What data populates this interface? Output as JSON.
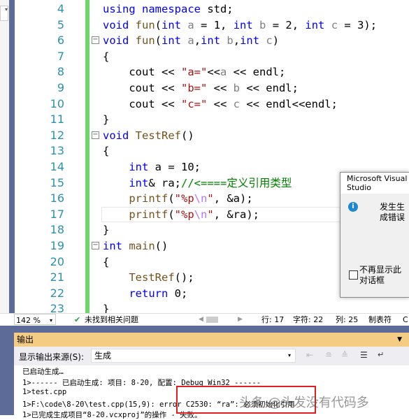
{
  "editor": {
    "lines": [
      {
        "n": "4",
        "fold": false,
        "parts": [
          [
            "kw",
            "using namespace"
          ],
          [
            "tx",
            " std;"
          ]
        ]
      },
      {
        "n": "5",
        "fold": false,
        "parts": [
          [
            "kw",
            "void"
          ],
          [
            "tx",
            " "
          ],
          [
            "fn",
            "fun"
          ],
          [
            "tx",
            "("
          ],
          [
            "kw",
            "int"
          ],
          [
            "tx",
            " "
          ],
          [
            "pm",
            "a"
          ],
          [
            "tx",
            " = 1, "
          ],
          [
            "kw",
            "int"
          ],
          [
            "tx",
            " "
          ],
          [
            "pm",
            "b"
          ],
          [
            "tx",
            " = 2, "
          ],
          [
            "kw",
            "int"
          ],
          [
            "tx",
            " "
          ],
          [
            "pm",
            "c"
          ],
          [
            "tx",
            " = 3);"
          ]
        ]
      },
      {
        "n": "6",
        "fold": true,
        "parts": [
          [
            "kw",
            "void"
          ],
          [
            "tx",
            " "
          ],
          [
            "fn",
            "fun"
          ],
          [
            "tx",
            "("
          ],
          [
            "kw",
            "int"
          ],
          [
            "tx",
            " "
          ],
          [
            "pm",
            "a"
          ],
          [
            "tx",
            ","
          ],
          [
            "kw",
            "int"
          ],
          [
            "tx",
            " "
          ],
          [
            "pm",
            "b"
          ],
          [
            "tx",
            ","
          ],
          [
            "kw",
            "int"
          ],
          [
            "tx",
            " "
          ],
          [
            "pm",
            "c"
          ],
          [
            "tx",
            ")"
          ]
        ]
      },
      {
        "n": "7",
        "fold": false,
        "parts": [
          [
            "tx",
            "{"
          ]
        ]
      },
      {
        "n": "8",
        "fold": false,
        "parts": [
          [
            "tx",
            "    cout << "
          ],
          [
            "st",
            "\"a=\""
          ],
          [
            "tx",
            "<<"
          ],
          [
            "pm",
            "a"
          ],
          [
            "tx",
            " << endl;"
          ]
        ]
      },
      {
        "n": "9",
        "fold": false,
        "parts": [
          [
            "tx",
            "    cout << "
          ],
          [
            "st",
            "\"b=\""
          ],
          [
            "tx",
            " << "
          ],
          [
            "pm",
            "b"
          ],
          [
            "tx",
            " << endl;"
          ]
        ]
      },
      {
        "n": "10",
        "fold": false,
        "parts": [
          [
            "tx",
            "    cout << "
          ],
          [
            "st",
            "\"c=\""
          ],
          [
            "tx",
            " << "
          ],
          [
            "pm",
            "c"
          ],
          [
            "tx",
            " << endl<<endl;"
          ]
        ]
      },
      {
        "n": "11",
        "fold": false,
        "parts": [
          [
            "tx",
            "}"
          ]
        ]
      },
      {
        "n": "12",
        "fold": true,
        "parts": [
          [
            "kw",
            "void"
          ],
          [
            "tx",
            " "
          ],
          [
            "fn",
            "TestRef"
          ],
          [
            "tx",
            "()"
          ]
        ]
      },
      {
        "n": "13",
        "fold": false,
        "parts": [
          [
            "tx",
            "{"
          ]
        ]
      },
      {
        "n": "14",
        "fold": false,
        "parts": [
          [
            "tx",
            "    "
          ],
          [
            "kw",
            "int"
          ],
          [
            "tx",
            " a = 10;"
          ]
        ]
      },
      {
        "n": "15",
        "fold": false,
        "parts": [
          [
            "tx",
            "    "
          ],
          [
            "kw",
            "int"
          ],
          [
            "tx",
            "& ra;"
          ],
          [
            "cm",
            "//<====定义引用类型"
          ]
        ]
      },
      {
        "n": "16",
        "fold": false,
        "parts": [
          [
            "tx",
            "    "
          ],
          [
            "fn",
            "printf"
          ],
          [
            "tx",
            "("
          ],
          [
            "st",
            "\"%p"
          ],
          [
            "esc",
            "\\n"
          ],
          [
            "st",
            "\""
          ],
          [
            "tx",
            ", &a);"
          ]
        ]
      },
      {
        "n": "17",
        "fold": false,
        "parts": [
          [
            "tx",
            "    "
          ],
          [
            "fn",
            "printf"
          ],
          [
            "tx",
            "("
          ],
          [
            "st",
            "\"%p"
          ],
          [
            "esc",
            "\\n"
          ],
          [
            "st",
            "\""
          ],
          [
            "tx",
            ", &ra);"
          ]
        ]
      },
      {
        "n": "18",
        "fold": false,
        "parts": [
          [
            "tx",
            "}"
          ]
        ]
      },
      {
        "n": "19",
        "fold": true,
        "parts": [
          [
            "kw",
            "int"
          ],
          [
            "tx",
            " "
          ],
          [
            "fn",
            "main"
          ],
          [
            "tx",
            "()"
          ]
        ]
      },
      {
        "n": "20",
        "fold": false,
        "parts": [
          [
            "tx",
            "{"
          ]
        ]
      },
      {
        "n": "21",
        "fold": false,
        "parts": [
          [
            "tx",
            "    "
          ],
          [
            "fn",
            "TestRef"
          ],
          [
            "tx",
            "();"
          ]
        ]
      },
      {
        "n": "22",
        "fold": false,
        "parts": [
          [
            "tx",
            "    "
          ],
          [
            "kw",
            "return"
          ],
          [
            "tx",
            " 0;"
          ]
        ]
      },
      {
        "n": "23",
        "fold": false,
        "parts": [
          [
            "tx",
            "}"
          ]
        ]
      }
    ]
  },
  "status": {
    "zoom": "142 %",
    "issues": "未找到相关问题",
    "row": "行: 17",
    "char": "字符: 22",
    "col": "列: 25",
    "tab": "制表符",
    "extra": "C"
  },
  "output": {
    "title": "输出",
    "source_label": "显示输出来源(S):",
    "source_value": "生成",
    "lines": [
      "已启动生成…",
      "1>------ 已启动生成: 项目: 8-20, 配置: Debug Win32 ------",
      "1>test.cpp",
      "1>F:\\code\\8-20\\test.cpp(15,9): error C2530: “ra”: 必须初始化引用",
      "1>已完成生成项目“8-20.vcxproj”的操作 - 失败。"
    ]
  },
  "dialog": {
    "title": "Microsoft Visual Studio",
    "message": "发生生成错误",
    "checkbox": "不再显示此对话框"
  },
  "watermark": "头条 @头发没有代码多",
  "colors": {
    "accent": "#5d6b99",
    "output_header": "#f5cc84",
    "error_box": "#e02020"
  }
}
